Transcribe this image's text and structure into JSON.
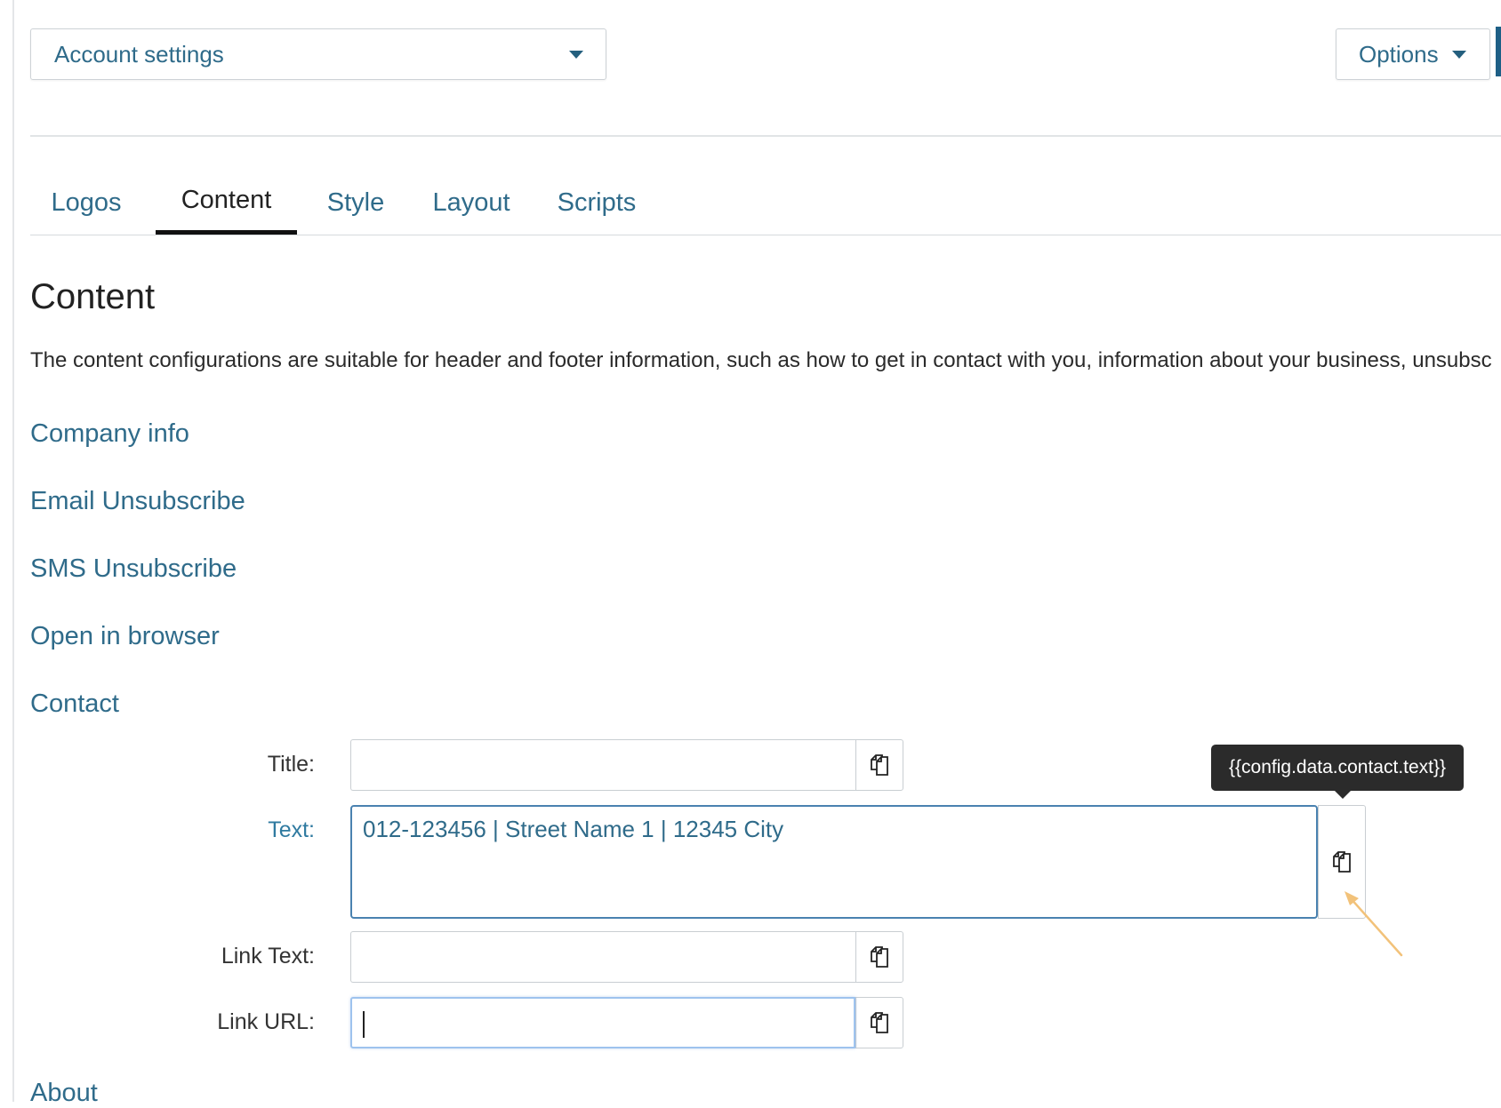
{
  "account_select": {
    "value": "Account settings"
  },
  "options_button": {
    "label": "Options"
  },
  "tabs": [
    {
      "label": "Logos",
      "active": false
    },
    {
      "label": "Content",
      "active": true
    },
    {
      "label": "Style",
      "active": false
    },
    {
      "label": "Layout",
      "active": false
    },
    {
      "label": "Scripts",
      "active": false
    }
  ],
  "page": {
    "title": "Content",
    "description": "The content configurations are suitable for header and footer information, such as how to get in contact with you, information about your business, unsubsc"
  },
  "sections": [
    {
      "label": "Company info"
    },
    {
      "label": "Email Unsubscribe"
    },
    {
      "label": "SMS Unsubscribe"
    },
    {
      "label": "Open in browser"
    },
    {
      "label": "Contact"
    },
    {
      "label": "About"
    }
  ],
  "contact_form": {
    "title_label": "Title:",
    "title_value": "",
    "text_label": "Text:",
    "text_value": "012-123456 | Street Name 1 | 12345 City",
    "link_text_label": "Link Text:",
    "link_text_value": "",
    "link_url_label": "Link URL:",
    "link_url_value": ""
  },
  "tooltip": {
    "text": "{{config.data.contact.text}}"
  },
  "icons": {
    "copy": "copy-icon",
    "caret": "caret-down-icon",
    "arrow": "pointer-arrow-icon"
  },
  "colors": {
    "link": "#2f6b8a",
    "focus_border": "#4a82b0",
    "tooltip_bg": "#2b2b2b",
    "annotation_arrow": "#f2c27a"
  }
}
